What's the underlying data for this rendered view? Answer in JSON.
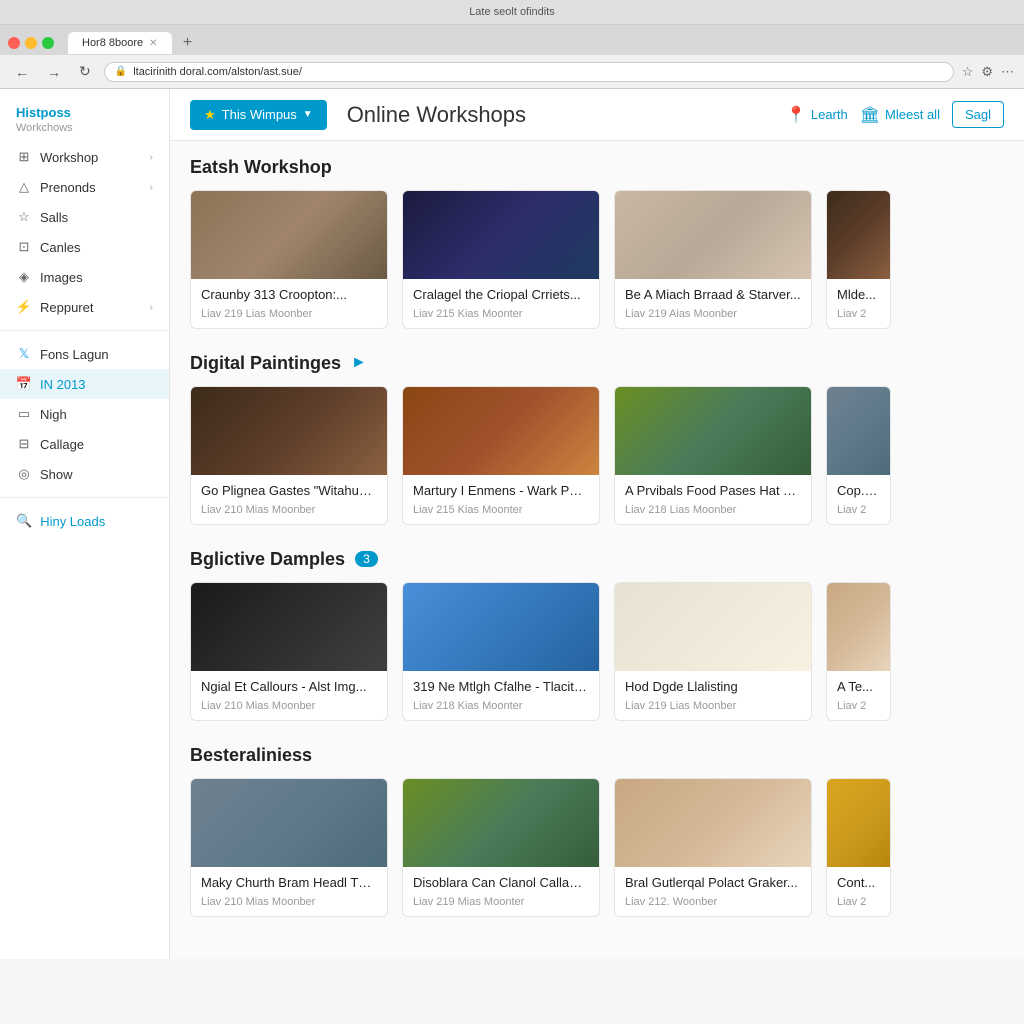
{
  "browser": {
    "title_bar": "Late seolt ofindits",
    "tab_label": "Hor8 8boore",
    "url": "ltacirinith doral.com/alston/ast.sue/"
  },
  "header": {
    "wimpus_label": "This Wimpus",
    "page_title": "Online Workshops",
    "learn_label": "Learth",
    "meet_label": "Mleest all",
    "sag_label": "Sagl"
  },
  "sidebar": {
    "section_title": "Histposs",
    "section_subtitle": "Workchows",
    "items": [
      {
        "id": "workshop",
        "label": "Workshop",
        "icon": "⊞",
        "has_arrow": true
      },
      {
        "id": "prenonds",
        "label": "Prenonds",
        "icon": "△",
        "has_arrow": true
      },
      {
        "id": "salls",
        "label": "Salls",
        "icon": "☆",
        "has_arrow": false
      },
      {
        "id": "canles",
        "label": "Canles",
        "icon": "⊡",
        "has_arrow": false
      },
      {
        "id": "images",
        "label": "Images",
        "icon": "◈",
        "has_arrow": false
      },
      {
        "id": "reppuret",
        "label": "Reppuret",
        "icon": "⚡",
        "has_arrow": true
      }
    ],
    "divider_item": "Fons Lagun",
    "active_item": "IN 2013",
    "bottom_items": [
      {
        "id": "nigh",
        "label": "Nigh",
        "icon": "▭"
      },
      {
        "id": "callage",
        "label": "Callage",
        "icon": "⊟"
      },
      {
        "id": "show",
        "label": "Show",
        "icon": "◎"
      }
    ],
    "load_more": "Hiny Loads"
  },
  "sections": [
    {
      "id": "eatsh",
      "title": "Eatsh Workshop",
      "badge": null,
      "has_arrow": false,
      "cards": [
        {
          "id": "card-1",
          "title": "Craunby 313 Croopton:...",
          "meta": "Liav 219 Lias Moonber",
          "img_class": "img-p1"
        },
        {
          "id": "card-2",
          "title": "Cralagel the Criopal Crriets...",
          "meta": "Liav 215 Kias Moonter",
          "img_class": "img-p2"
        },
        {
          "id": "card-3",
          "title": "Be A Miach Brraad & Starver...",
          "meta": "Liav 219 Aias Moonber",
          "img_class": "img-p3"
        },
        {
          "id": "card-4",
          "title": "Mlde...",
          "meta": "Liav 2",
          "img_class": "img-p4",
          "overflow": true
        }
      ]
    },
    {
      "id": "digital",
      "title": "Digital Paintinges",
      "badge": null,
      "has_arrow": true,
      "cards": [
        {
          "id": "card-5",
          "title": "Go Plignea Gastes \"Witahug\" Besspect Need",
          "meta": "Liav 210 Mias Moonber",
          "img_class": "img-p4"
        },
        {
          "id": "card-6",
          "title": "Martury I Enmens - Wark Puljle... Woing Titan the Aplirts...",
          "meta": "Liav 215 Kias Moonter",
          "img_class": "img-p8"
        },
        {
          "id": "card-7",
          "title": "A Prvibals Food Pases Hat Tarle",
          "meta": "Liav 218 Lias Moonber",
          "img_class": "img-p5"
        },
        {
          "id": "card-8",
          "title": "Cop... Conf...",
          "meta": "Liav 2",
          "img_class": "img-p11",
          "overflow": true
        }
      ]
    },
    {
      "id": "bglictive",
      "title": "Bglictive Damples",
      "badge": "3",
      "has_arrow": false,
      "cards": [
        {
          "id": "card-9",
          "title": "Ngial Et Callours - Alst Img...",
          "meta": "Liav 210 Mias Moonber",
          "img_class": "img-p6"
        },
        {
          "id": "card-10",
          "title": "319 Ne Mtlgh Cfalhe - Tlacite...",
          "meta": "Liav 218 Kias Moonter",
          "img_class": "img-p7"
        },
        {
          "id": "card-11",
          "title": "Hod Dgde Llalisting",
          "meta": "Liav 219 Lias Moonber",
          "img_class": "img-p10"
        },
        {
          "id": "card-12",
          "title": "A Te...",
          "meta": "Liav 2",
          "img_class": "img-p9",
          "overflow": true
        }
      ]
    },
    {
      "id": "besteraliniess",
      "title": "Besteraliniess",
      "badge": null,
      "has_arrow": false,
      "cards": [
        {
          "id": "card-13",
          "title": "Maky Churth Bram Headl Thiar Posinal Migs",
          "meta": "Liav 210 Mias Moonber",
          "img_class": "img-p11"
        },
        {
          "id": "card-14",
          "title": "Disoblara Can Clanol Callage In Merricalt Frad",
          "meta": "Liav 219 Mias Moonter",
          "img_class": "img-p5"
        },
        {
          "id": "card-15",
          "title": "Bral Gutlerqal Polact Graker...",
          "meta": "Liav 212. Woonber",
          "img_class": "img-p9"
        },
        {
          "id": "card-16",
          "title": "Cont...",
          "meta": "Liav 2",
          "img_class": "img-p12",
          "overflow": true
        }
      ]
    }
  ]
}
